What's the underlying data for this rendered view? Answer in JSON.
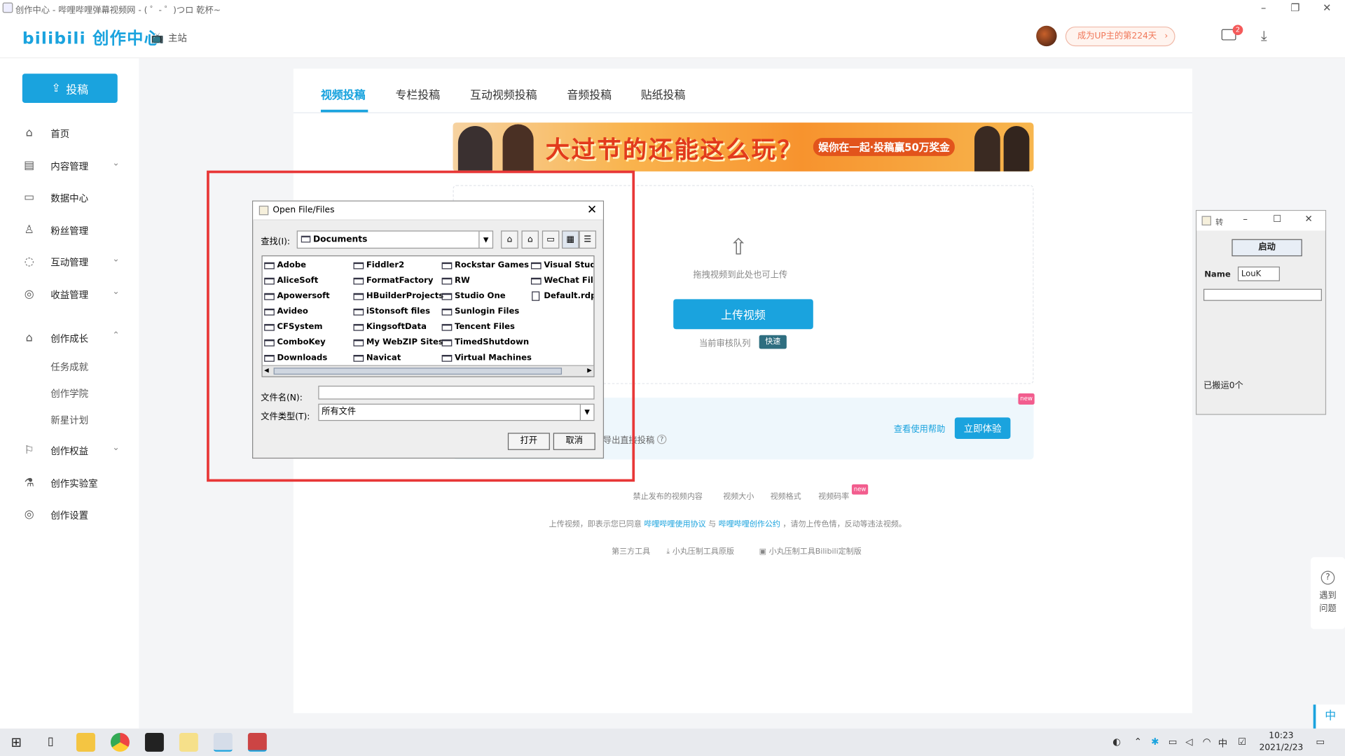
{
  "window": {
    "title": "创作中心 - 哔哩哔哩弹幕视频网 - ( ゜- ゜)つロ 乾杯~"
  },
  "header": {
    "logo": "bilibili 创作中心",
    "home_link": "主站",
    "up_days": "成为UP主的第224天",
    "mail_badge": "2"
  },
  "sidebar": {
    "submit_label": "投稿",
    "items": [
      {
        "label": "首页",
        "icon": "home-icon"
      },
      {
        "label": "内容管理",
        "icon": "content-icon"
      },
      {
        "label": "数据中心",
        "icon": "chart-icon"
      },
      {
        "label": "粉丝管理",
        "icon": "user-icon"
      },
      {
        "label": "互动管理",
        "icon": "chat-icon"
      },
      {
        "label": "收益管理",
        "icon": "money-icon"
      },
      {
        "label": "创作成长",
        "icon": "hat-icon"
      },
      {
        "label": "创作权益",
        "icon": "flag-icon"
      },
      {
        "label": "创作实验室",
        "icon": "flask-icon"
      },
      {
        "label": "创作设置",
        "icon": "settings-icon"
      }
    ],
    "growth_sub": [
      "任务成就",
      "创作学院",
      "新星计划"
    ]
  },
  "tabs": [
    "视频投稿",
    "专栏投稿",
    "互动视频投稿",
    "音频投稿",
    "贴纸投稿"
  ],
  "banner": {
    "headline": "大过节的还能这么玩？",
    "sub": "娱你在一起·投稿赢50万奖金"
  },
  "upload": {
    "drag_text": "拖拽视频到此处也可上传",
    "button": "上传视频",
    "queue_label": "当前审核队列",
    "queue_status": "快速"
  },
  "promo": {
    "partial_text": "导出直接投稿",
    "help_link": "查看使用帮助",
    "try_button": "立即体验",
    "new_badge": "new"
  },
  "links": [
    "禁止发布的视频内容",
    "视频大小",
    "视频格式",
    "视频码率"
  ],
  "agreement": {
    "prefix": "上传视频，即表示您已同意",
    "link1": "哔哩哔哩使用协议",
    "mid": "与",
    "link2": "哔哩哔哩创作公约",
    "suffix": "，请勿上传色情，反动等违法视频。"
  },
  "tools": [
    "第三方工具",
    "小丸压制工具原版",
    "小丸压制工具Bilibili定制版"
  ],
  "faq": {
    "text1": "遇到",
    "text2": "问题"
  },
  "ime": "中",
  "dialog": {
    "title": "Open File/Files",
    "look_in_label": "查找(I):",
    "look_in_value": "Documents",
    "files": [
      "Adobe",
      "AliceSoft",
      "Apowersoft",
      "Avideo",
      "CFSystem",
      "ComboKey",
      "Downloads",
      "Fiddler2",
      "FormatFactory",
      "HBuilderProjects",
      "iStonsoft files",
      "KingsoftData",
      "My WebZIP Sites",
      "Navicat",
      "Rockstar Games",
      "RW",
      "Studio One",
      "Sunlogin Files",
      "Tencent Files",
      "TimedShutdown",
      "Virtual Machines",
      "Visual Studio",
      "WeChat Files",
      "Default.rdp"
    ],
    "filename_label": "文件名(N):",
    "filename_value": "",
    "filetype_label": "文件类型(T):",
    "filetype_value": "所有文件",
    "open_button": "打开",
    "cancel_button": "取消"
  },
  "mini_window": {
    "title": "转",
    "start_button": "启动",
    "name_label": "Name",
    "name_value": "LouK",
    "status": "已搬运0个"
  },
  "taskbar": {
    "time": "10:23",
    "date": "2021/2/23"
  },
  "colors": {
    "accent": "#1aa3de",
    "highlight_box": "#e83737",
    "pink_badge": "#f25d8e"
  }
}
